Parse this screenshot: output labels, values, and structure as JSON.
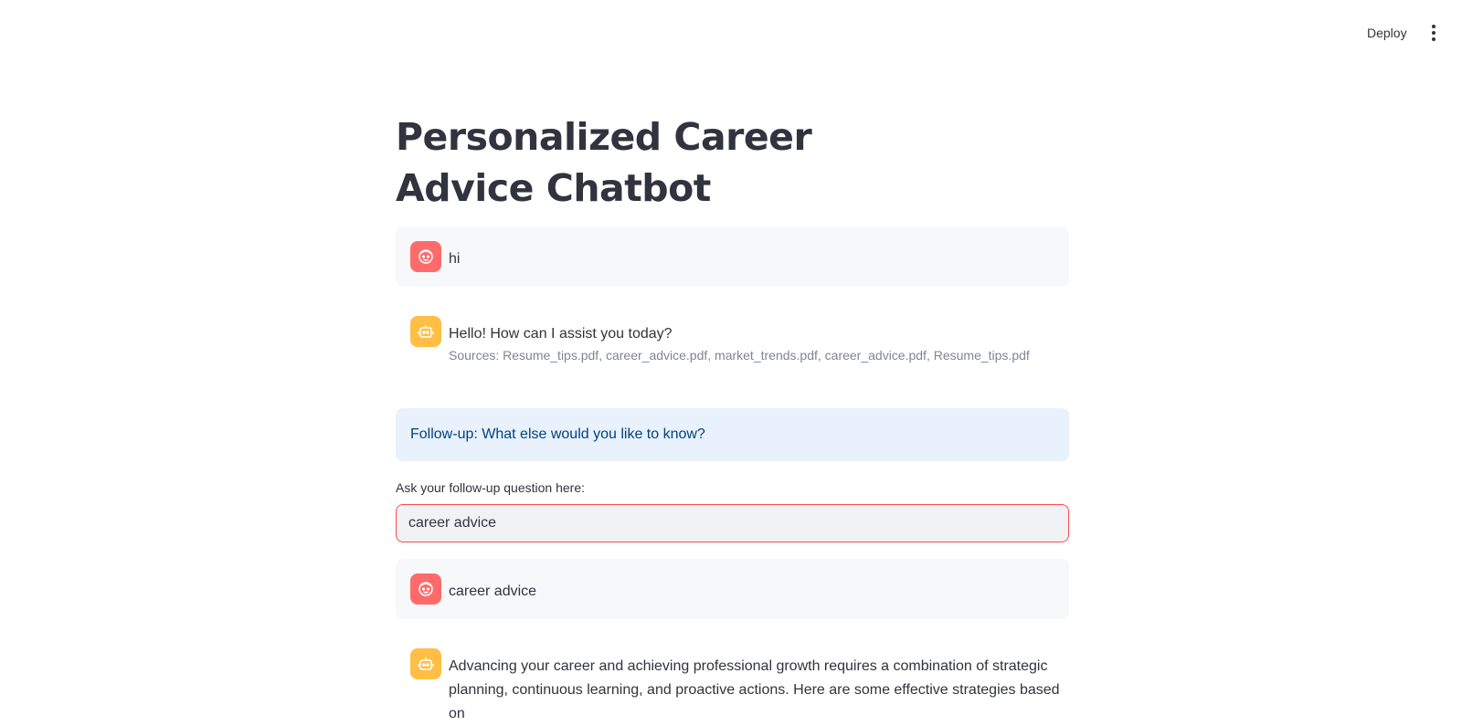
{
  "topbar": {
    "deploy_label": "Deploy",
    "menu_icon": "kebab-menu-icon"
  },
  "page": {
    "title": "Personalized Career Advice Chatbot"
  },
  "messages": [
    {
      "role": "user",
      "icon": "user-face-icon",
      "text": "hi"
    },
    {
      "role": "assistant",
      "icon": "robot-icon",
      "text": "Hello! How can I assist you today?",
      "sources": "Sources: Resume_tips.pdf, career_advice.pdf, market_trends.pdf, career_advice.pdf, Resume_tips.pdf"
    },
    {
      "role": "user",
      "icon": "user-face-icon",
      "text": "career advice"
    },
    {
      "role": "assistant",
      "icon": "robot-icon",
      "text": "Advancing your career and achieving professional growth requires a combination of strategic planning, continuous learning, and proactive actions. Here are some effective strategies based on"
    }
  ],
  "followup": {
    "info_text": "Follow-up: What else would you like to know?",
    "input_label": "Ask your follow-up question here:",
    "input_value": "career advice"
  },
  "colors": {
    "user_avatar": "#ff6b6b",
    "bot_avatar": "#ffbe45",
    "info_bg": "#e8f1fc",
    "info_text": "#004280",
    "input_border_focus": "#ff4b4b"
  }
}
